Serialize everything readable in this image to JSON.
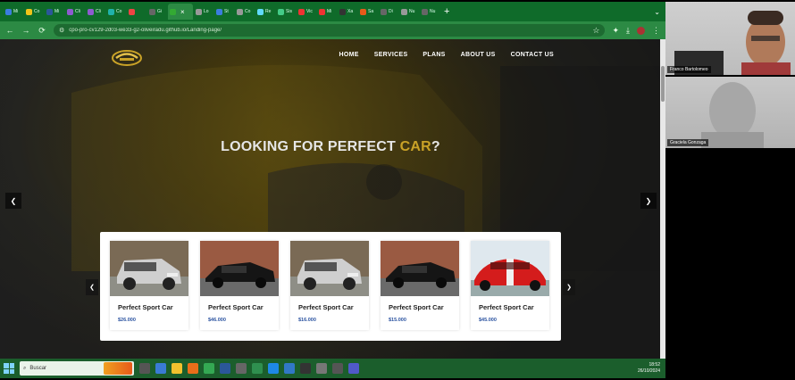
{
  "browser": {
    "tabs": [
      {
        "label": "Mi",
        "color": "#3b7de0"
      },
      {
        "label": "Co",
        "color": "#f0c419"
      },
      {
        "label": "Mi",
        "color": "#2b579a"
      },
      {
        "label": "Cli",
        "color": "#8e5bd0"
      },
      {
        "label": "Cli",
        "color": "#8e5bd0"
      },
      {
        "label": "Co",
        "color": "#20b2aa"
      },
      {
        "label": "",
        "color": "#e44"
      },
      {
        "label": "Gi",
        "color": "#666"
      },
      {
        "label": "",
        "color": "#3a3",
        "active": true
      },
      {
        "label": "Lo",
        "color": "#999"
      },
      {
        "label": "St",
        "color": "#3b7de0"
      },
      {
        "label": "Co",
        "color": "#999"
      },
      {
        "label": "Re",
        "color": "#61dafb"
      },
      {
        "label": "Sis",
        "color": "#4c8"
      },
      {
        "label": "Vic",
        "color": "#e33"
      },
      {
        "label": "Mi",
        "color": "#e33"
      },
      {
        "label": "Xa",
        "color": "#333"
      },
      {
        "label": "Sa",
        "color": "#e85a1a"
      },
      {
        "label": "Di",
        "color": "#666"
      },
      {
        "label": "Nu",
        "color": "#999"
      },
      {
        "label": "Nu",
        "color": "#666"
      }
    ],
    "url": "cpo-pro-cv129-2d03-we33-g2-oliveiradu.github.io/Landing-page/",
    "icons": {
      "back": "←",
      "forward": "→",
      "reload": "⟳",
      "star": "☆",
      "new_tab": "+",
      "close": "×"
    }
  },
  "site": {
    "nav": [
      "HOME",
      "SERVICES",
      "PLANS",
      "ABOUT US",
      "CONTACT US"
    ],
    "hero": {
      "title_main": "LOOKING FOR PERFECT ",
      "title_accent": "CAR",
      "title_end": "?"
    },
    "accent_color": "#c9a227",
    "cars": [
      {
        "title": "Perfect Sport Car",
        "price": "$26.000",
        "image": "silver-suv"
      },
      {
        "title": "Perfect Sport Car",
        "price": "$46.000",
        "image": "black-sedan"
      },
      {
        "title": "Perfect Sport Car",
        "price": "$16.000",
        "image": "silver-suv"
      },
      {
        "title": "Perfect Sport Car",
        "price": "$15.000",
        "image": "black-sedan"
      },
      {
        "title": "Perfect Sport Car",
        "price": "$45.000",
        "image": "red-sports-car"
      }
    ]
  },
  "taskbar": {
    "search_placeholder": "Buscar",
    "time": "18:52",
    "date": "26/10/2024"
  },
  "participants": [
    {
      "name": "Franco Bartolomeo"
    },
    {
      "name": "Graciela Gonzaga"
    }
  ]
}
